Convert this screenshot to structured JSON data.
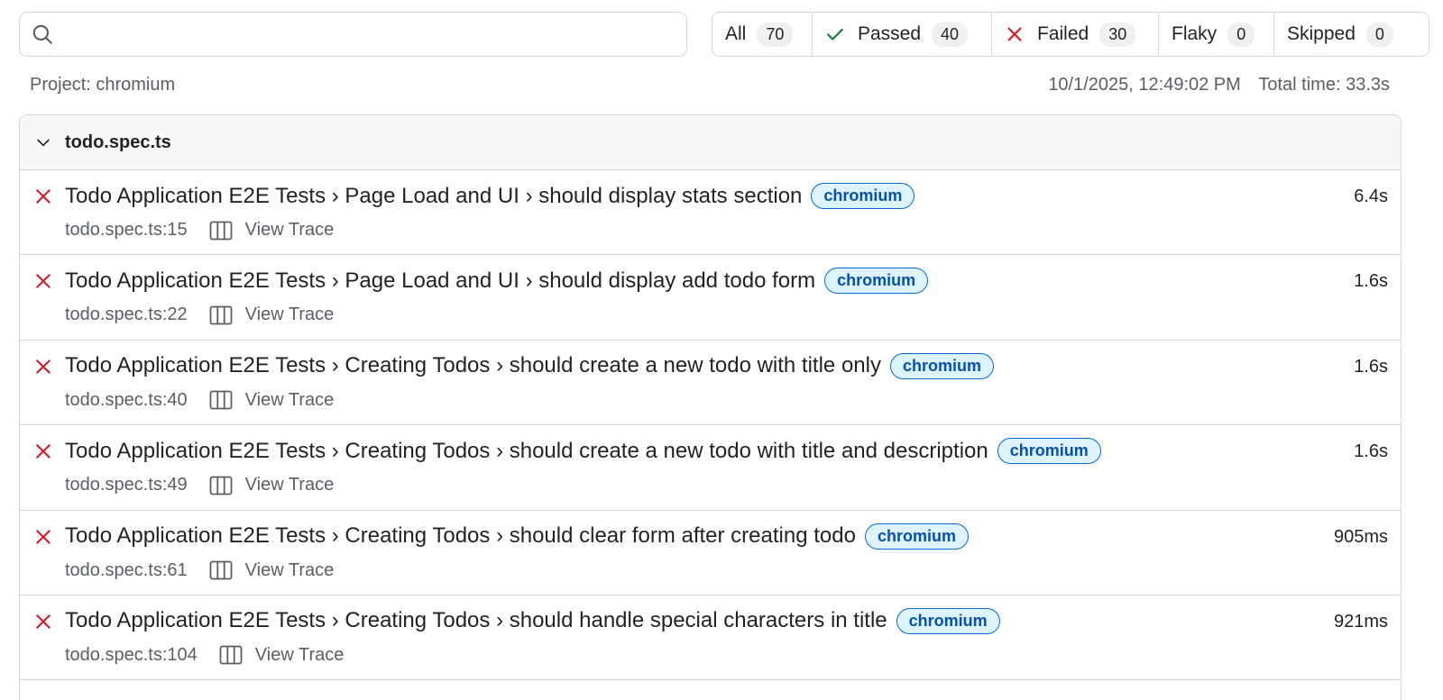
{
  "search": {
    "value": "",
    "placeholder": ""
  },
  "filters": [
    {
      "label": "All",
      "count": "70",
      "icon": ""
    },
    {
      "label": "Passed",
      "count": "40",
      "icon": "check-icon"
    },
    {
      "label": "Failed",
      "count": "30",
      "icon": "x-icon"
    },
    {
      "label": "Flaky",
      "count": "0",
      "icon": ""
    },
    {
      "label": "Skipped",
      "count": "0",
      "icon": ""
    }
  ],
  "meta": {
    "project": "Project: chromium",
    "timestamp": "10/1/2025, 12:49:02 PM",
    "total_time": "Total time: 33.3s"
  },
  "group": {
    "name": "todo.spec.ts"
  },
  "colors": {
    "failed": "#cf222e",
    "passed": "#1a7f37",
    "tag_bg": "#ddf4ff",
    "tag_text": "#0550ae"
  },
  "tests": [
    {
      "title": "Todo Application E2E Tests › Page Load and UI › should display stats section",
      "tag": "chromium",
      "location": "todo.spec.ts:15",
      "trace": "View Trace",
      "duration": "6.4s",
      "status": "failed"
    },
    {
      "title": "Todo Application E2E Tests › Page Load and UI › should display add todo form",
      "tag": "chromium",
      "location": "todo.spec.ts:22",
      "trace": "View Trace",
      "duration": "1.6s",
      "status": "failed"
    },
    {
      "title": "Todo Application E2E Tests › Creating Todos › should create a new todo with title only",
      "tag": "chromium",
      "location": "todo.spec.ts:40",
      "trace": "View Trace",
      "duration": "1.6s",
      "status": "failed"
    },
    {
      "title": "Todo Application E2E Tests › Creating Todos › should create a new todo with title and description",
      "tag": "chromium",
      "location": "todo.spec.ts:49",
      "trace": "View Trace",
      "duration": "1.6s",
      "status": "failed"
    },
    {
      "title": "Todo Application E2E Tests › Creating Todos › should clear form after creating todo",
      "tag": "chromium",
      "location": "todo.spec.ts:61",
      "trace": "View Trace",
      "duration": "905ms",
      "status": "failed"
    },
    {
      "title": "Todo Application E2E Tests › Creating Todos › should handle special characters in title",
      "tag": "chromium",
      "location": "todo.spec.ts:104",
      "trace": "View Trace",
      "duration": "921ms",
      "status": "failed"
    }
  ]
}
